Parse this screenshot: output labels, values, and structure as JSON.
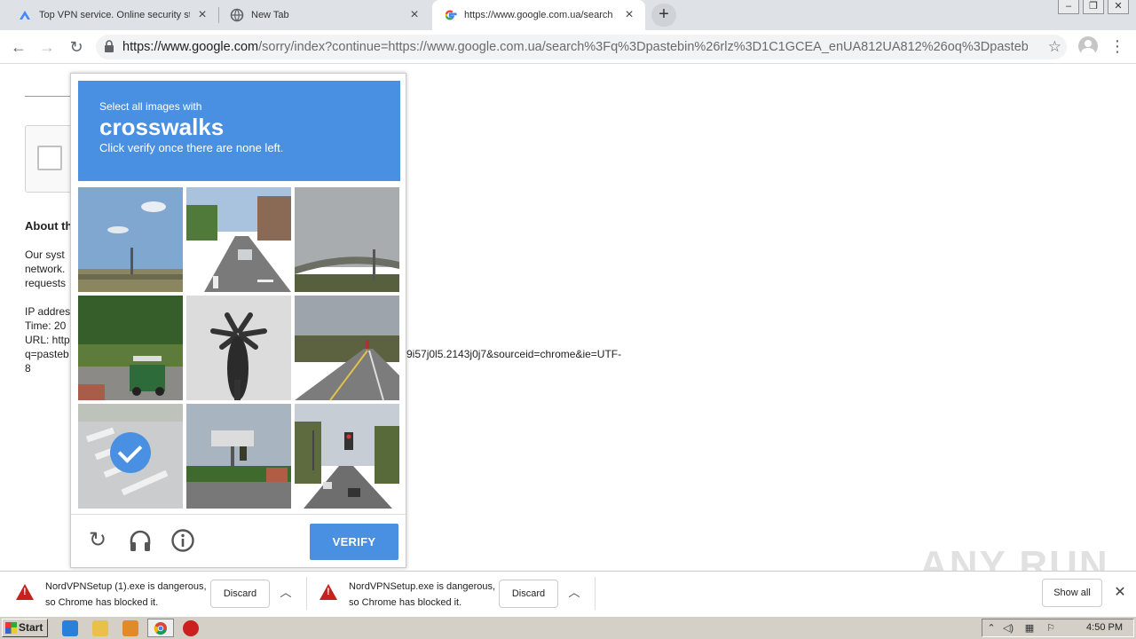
{
  "tabs": [
    {
      "title": "Top VPN service. Online security sta",
      "icon": "nordvpn-icon"
    },
    {
      "title": "New Tab",
      "icon": "globe-icon"
    },
    {
      "title": "https://www.google.com.ua/search",
      "icon": "google-icon",
      "active": true
    }
  ],
  "window_controls": {
    "minimize": "–",
    "restore": "❐",
    "close": "✕"
  },
  "address": {
    "host": "https://www.google.com",
    "rest": "/sorry/index?continue=https://www.google.com.ua/search%3Fq%3Dpastebin%26rlz%3D1C1GCEA_enUA812UA812%26oq%3Dpastebin..."
  },
  "page": {
    "about_heading": "About th",
    "line1": "Our syst",
    "line2": "network.",
    "line3": "requests",
    "ip": "IP addres",
    "time": "Time: 20",
    "url_label": "URL: http",
    "url_cont": "q=pasteb",
    "url_tail": "9i57j0l5.2143j0j7&sourceid=chrome&ie=UTF-",
    "url_end": "8"
  },
  "captcha": {
    "instruction": "Select all images with",
    "target": "crosswalks",
    "hint": "Click verify once there are none left.",
    "verify_label": "VERIFY",
    "selected_tile": 7
  },
  "downloads": [
    {
      "line1": "NordVPNSetup (1).exe is dangerous,",
      "line2": "so Chrome has blocked it.",
      "discard": "Discard"
    },
    {
      "line1": "NordVPNSetup.exe is dangerous,",
      "line2": "so Chrome has blocked it.",
      "discard": "Discard"
    }
  ],
  "show_all": "Show all",
  "watermark": "ANY RUN",
  "taskbar": {
    "start": "Start",
    "time": "4:50 PM"
  },
  "colors": {
    "accent": "#4a90e2",
    "danger": "#c5221f"
  }
}
